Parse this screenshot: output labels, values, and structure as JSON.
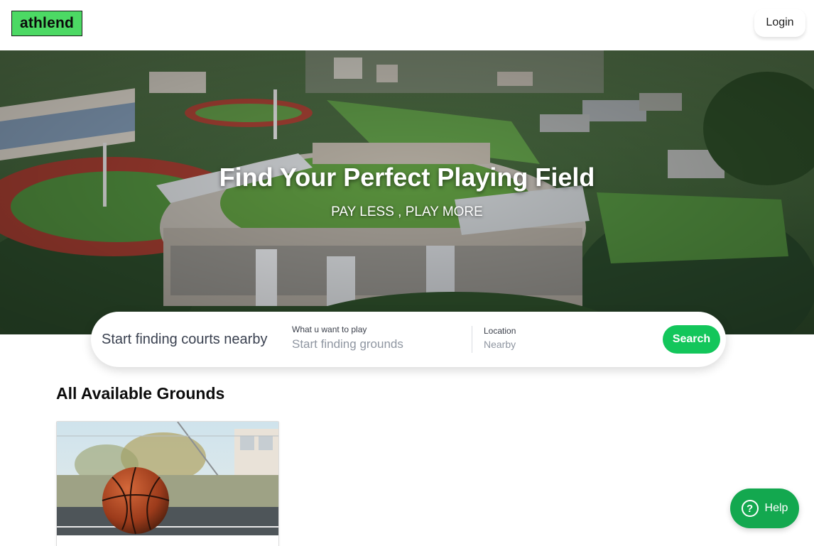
{
  "header": {
    "logo_text": "athlend",
    "login_label": "Login"
  },
  "hero": {
    "title": "Find Your Perfect Playing Field",
    "subtitle": "PAY LESS , PLAY MORE"
  },
  "search": {
    "lead_text": "Start finding courts nearby",
    "sport_label": "What u want to play",
    "sport_placeholder": "Start finding grounds",
    "location_label": "Location",
    "location_placeholder": "Nearby",
    "button_label": "Search"
  },
  "grounds": {
    "title": "All Available Grounds"
  },
  "help": {
    "icon_glyph": "?",
    "label": "Help"
  },
  "colors": {
    "brand_green": "#4cd964",
    "accent_green": "#13c65b",
    "help_green": "#13a84f"
  }
}
